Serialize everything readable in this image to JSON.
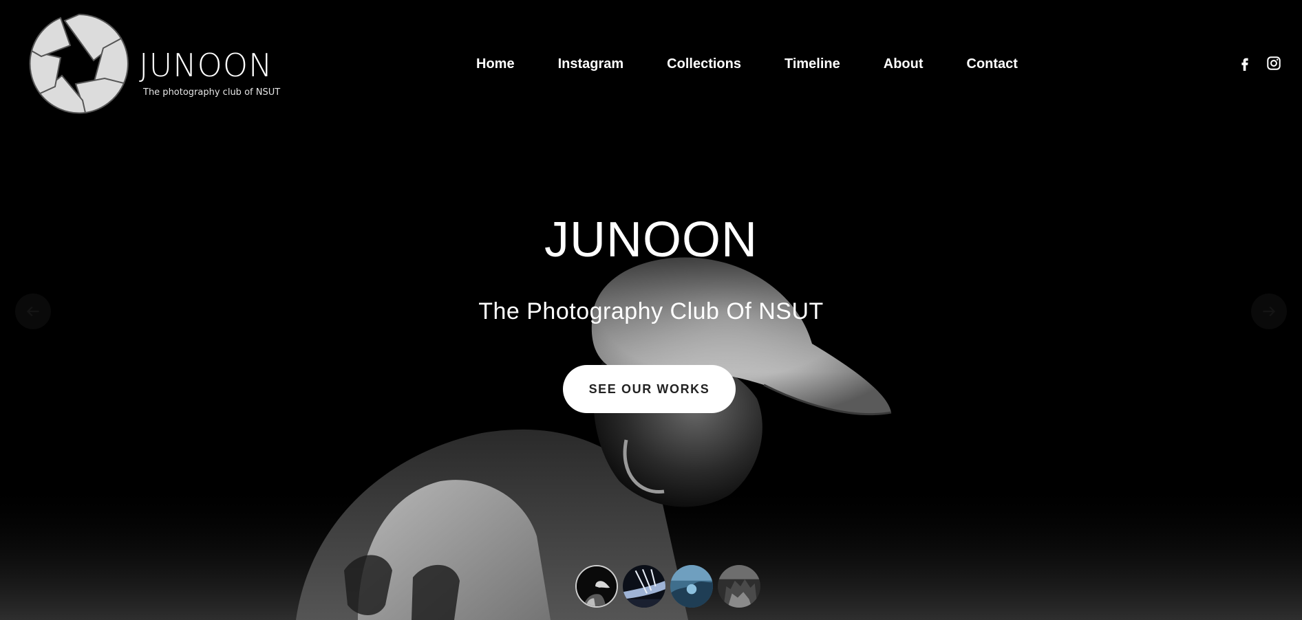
{
  "site": {
    "logo_title": "JUNOON",
    "logo_subtitle": "The photography club of NSUT"
  },
  "nav": {
    "items": [
      {
        "label": "Home"
      },
      {
        "label": "Instagram"
      },
      {
        "label": "Collections"
      },
      {
        "label": "Timeline"
      },
      {
        "label": "About"
      },
      {
        "label": "Contact"
      }
    ]
  },
  "socials": {
    "icons": [
      "facebook-icon",
      "instagram-icon"
    ]
  },
  "hero": {
    "title": "JUNOON",
    "subtitle": "The Photography Club Of NSUT",
    "cta_label": "SEE OUR WORKS"
  },
  "slider": {
    "active_index": 0,
    "thumbnail_count": 4
  },
  "colors": {
    "background": "#000000",
    "text": "#ffffff",
    "button_bg": "#ffffff",
    "button_text": "#222222"
  }
}
